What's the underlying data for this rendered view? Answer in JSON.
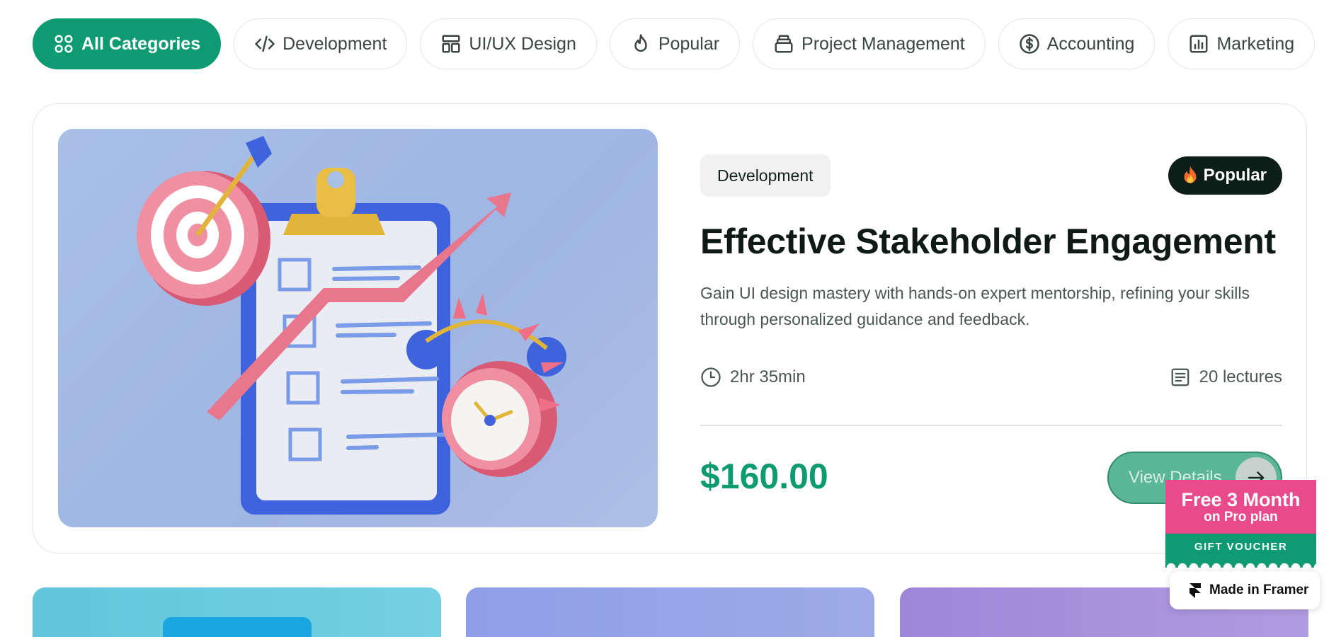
{
  "categories": [
    {
      "label": "All Categories",
      "icon": "grid-icon",
      "active": true
    },
    {
      "label": "Development",
      "icon": "code-icon",
      "active": false
    },
    {
      "label": "UI/UX Design",
      "icon": "layout-icon",
      "active": false
    },
    {
      "label": "Popular",
      "icon": "flame-icon",
      "active": false
    },
    {
      "label": "Project Management",
      "icon": "briefcase-icon",
      "active": false
    },
    {
      "label": "Accounting",
      "icon": "dollar-circle-icon",
      "active": false
    },
    {
      "label": "Marketing",
      "icon": "bar-chart-icon",
      "active": false
    }
  ],
  "featured": {
    "tag": "Development",
    "badge": "Popular",
    "title": "Effective Stakeholder Engagement",
    "description": "Gain UI design mastery with hands-on expert mentorship, refining your skills through personalized guidance and feedback.",
    "duration": "2hr 35min",
    "lectures": "20 lectures",
    "price": "$160.00",
    "cta": "View Details"
  },
  "voucher": {
    "headline": "Free 3 Month",
    "subline": "on Pro plan",
    "label": "GIFT VOUCHER"
  },
  "framer_badge": "Made in Framer",
  "colors": {
    "accent": "#0f9b71",
    "dark_badge": "#0c1e17",
    "voucher_pink": "#e84a8b"
  }
}
